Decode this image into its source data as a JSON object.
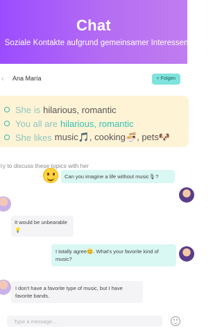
{
  "hero": {
    "title": "Chat",
    "subtitle": "Soziale Kontakte aufgrund gemeinsamer Interessen"
  },
  "header": {
    "contact_name": "Ana María",
    "follow_label": "+ Folgen",
    "back_icon": "arrow-left-icon"
  },
  "interests": [
    {
      "prefix": "She is",
      "values": "hilarious, romantic",
      "highlight": false
    },
    {
      "prefix": "You all are",
      "values": "hilarious, romantic",
      "highlight": true
    },
    {
      "prefix": "She likes",
      "values": "music🎵, cooking🍜, pets🐶",
      "highlight": false
    }
  ],
  "topic_hint": "Try to discuss these topics with her",
  "messages": [
    {
      "direction": "out",
      "text": "Can you imagine a life without music🎙?"
    },
    {
      "direction": "in",
      "text": "It would be unbearable💡"
    },
    {
      "direction": "out",
      "text": "I totally agree😊. What's your favorite kind of music?"
    },
    {
      "direction": "in",
      "text": "I don't have a favorite type of music, but I have favorite bands."
    }
  ],
  "composer": {
    "placeholder": "Type a message...",
    "emoji_icon": "smiley-icon"
  },
  "colors": {
    "hero_start": "#9b4dff",
    "hero_end": "#c07df0",
    "follow_bg": "#7fe3dd",
    "interest_card_bg": "#fff3d6",
    "accent_teal": "#2fc3b4",
    "outgoing_bubble": "#d9f7f3",
    "incoming_bubble": "#f4f4f6"
  }
}
